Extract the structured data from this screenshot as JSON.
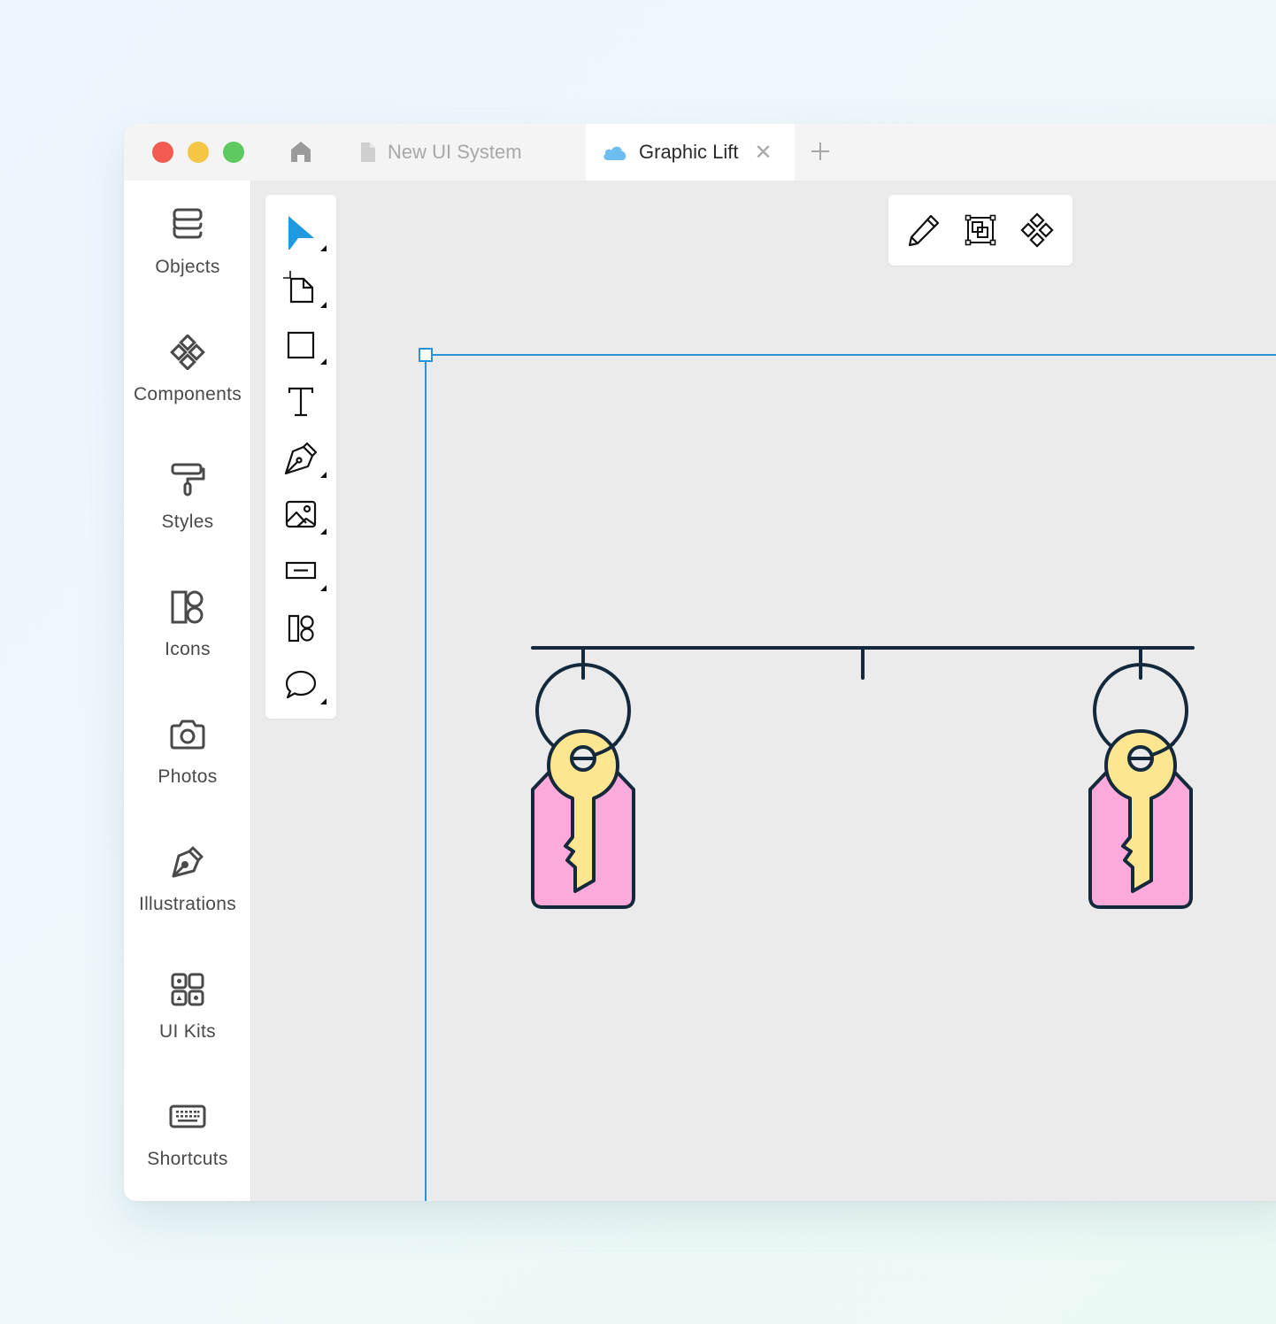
{
  "window": {
    "tabs": [
      {
        "label": "New UI System",
        "icon": "document-icon",
        "active": false
      },
      {
        "label": "Graphic Lift",
        "icon": "cloud-icon",
        "active": true,
        "closable": true
      }
    ],
    "new_tab_symbol": "+",
    "close_symbol": "✕"
  },
  "sidebar": {
    "items": [
      {
        "label": "Objects",
        "icon": "layers-icon"
      },
      {
        "label": "Components",
        "icon": "components-icon"
      },
      {
        "label": "Styles",
        "icon": "paint-roller-icon"
      },
      {
        "label": "Icons",
        "icon": "icons-icon"
      },
      {
        "label": "Photos",
        "icon": "camera-icon"
      },
      {
        "label": "Illustrations",
        "icon": "pen-nib-icon"
      },
      {
        "label": "UI Kits",
        "icon": "ui-kits-icon"
      },
      {
        "label": "Shortcuts",
        "icon": "keyboard-icon"
      }
    ]
  },
  "toolbar": {
    "tools": [
      {
        "name": "select",
        "icon": "cursor-arrow-icon",
        "active": true,
        "has_submenu": true
      },
      {
        "name": "artboard",
        "icon": "artboard-icon",
        "has_submenu": true
      },
      {
        "name": "rectangle",
        "icon": "rectangle-icon",
        "has_submenu": true
      },
      {
        "name": "text",
        "icon": "text-icon",
        "has_submenu": false
      },
      {
        "name": "pen",
        "icon": "pen-icon",
        "has_submenu": true
      },
      {
        "name": "image",
        "icon": "image-icon",
        "has_submenu": true
      },
      {
        "name": "button",
        "icon": "button-icon",
        "has_submenu": true
      },
      {
        "name": "icons",
        "icon": "icons-icon",
        "has_submenu": false
      },
      {
        "name": "comment",
        "icon": "comment-icon",
        "has_submenu": true
      }
    ]
  },
  "context_toolbar": {
    "buttons": [
      {
        "name": "edit",
        "icon": "pencil-icon"
      },
      {
        "name": "group",
        "icon": "group-icon"
      },
      {
        "name": "create-component",
        "icon": "components-icon"
      }
    ]
  },
  "colors": {
    "accent": "#2a93d5",
    "select_tool": "#1f9ae0",
    "key_fill": "#fce68f",
    "tag_fill": "#fcaadb",
    "stroke": "#15293d"
  }
}
